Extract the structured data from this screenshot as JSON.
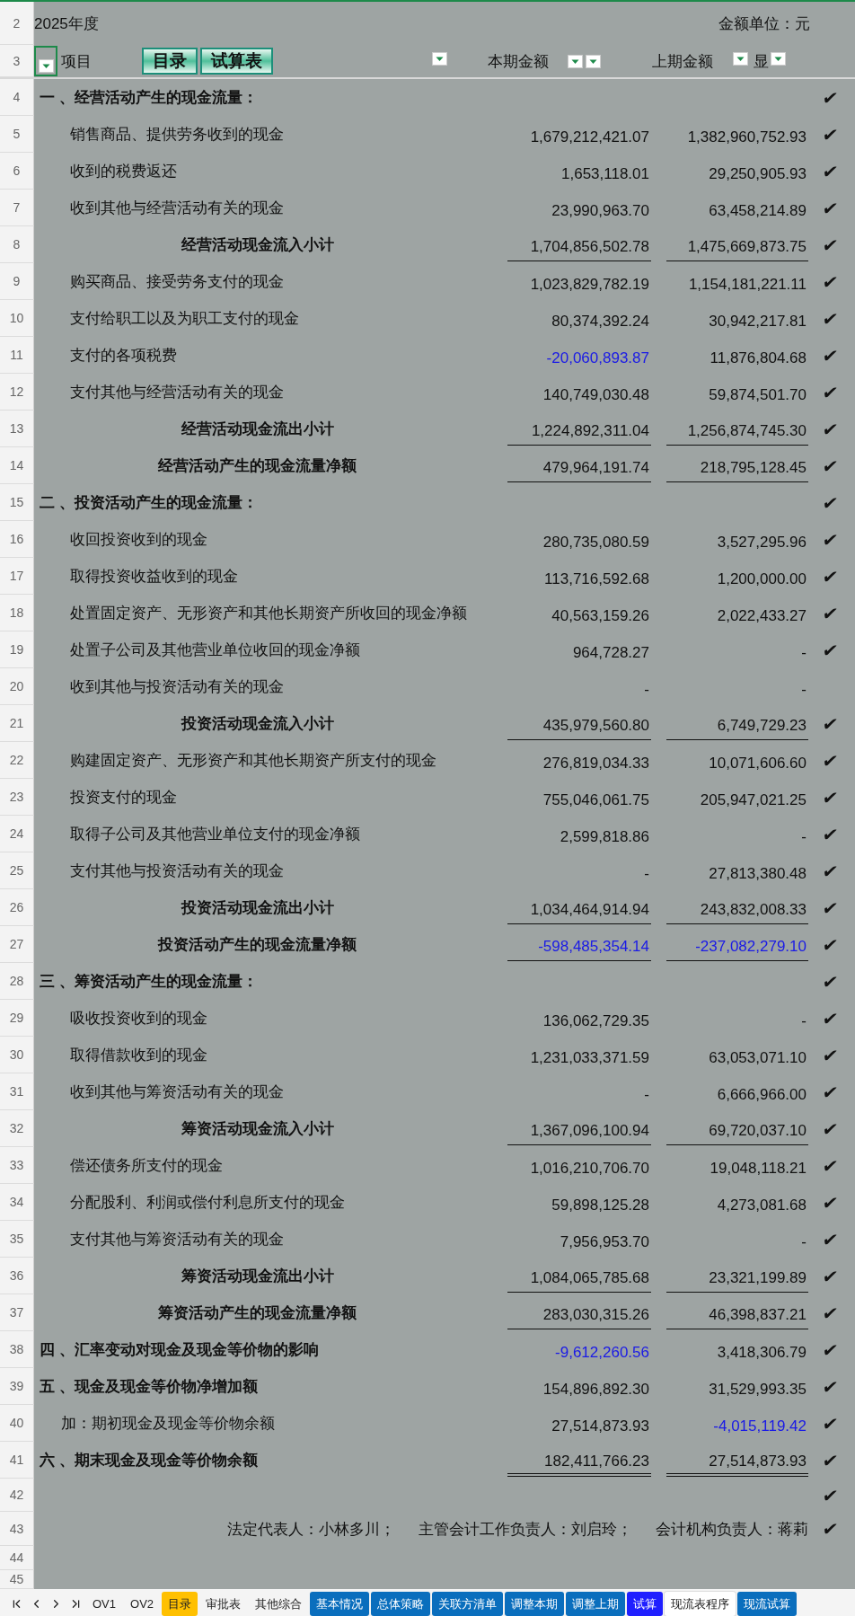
{
  "top": {
    "row": "2",
    "year": "2025年度",
    "unit": "金额单位：元"
  },
  "header": {
    "row": "3",
    "label": "项目",
    "buttons": [
      "目录",
      "试算表"
    ],
    "columns": [
      "本期金额",
      "上期金额",
      "显"
    ]
  },
  "rows": [
    {
      "row": "4",
      "kind": "section",
      "underlined": false,
      "double_rule": false,
      "label": "一 、经营活动产生的现金流量：",
      "check": "✔"
    },
    {
      "row": "5",
      "kind": "item",
      "underlined": false,
      "double_rule": false,
      "label": "销售商品、提供劳务收到的现金",
      "current": {
        "text": "1,679,212,421.07",
        "negative": false
      },
      "prior": {
        "text": "1,382,960,752.93",
        "negative": false
      },
      "check": "✔"
    },
    {
      "row": "6",
      "kind": "item",
      "underlined": false,
      "double_rule": false,
      "label": "收到的税费返还",
      "current": {
        "text": "1,653,118.01",
        "negative": false
      },
      "prior": {
        "text": "29,250,905.93",
        "negative": false
      },
      "check": "✔"
    },
    {
      "row": "7",
      "kind": "item",
      "underlined": false,
      "double_rule": false,
      "label": "收到其他与经营活动有关的现金",
      "current": {
        "text": "23,990,963.70",
        "negative": false
      },
      "prior": {
        "text": "63,458,214.89",
        "negative": false
      },
      "check": "✔"
    },
    {
      "row": "8",
      "kind": "total",
      "underlined": true,
      "double_rule": false,
      "label": "经营活动现金流入小计",
      "current": {
        "text": "1,704,856,502.78",
        "negative": false
      },
      "prior": {
        "text": "1,475,669,873.75",
        "negative": false
      },
      "check": "✔"
    },
    {
      "row": "9",
      "kind": "item",
      "underlined": false,
      "double_rule": false,
      "label": "购买商品、接受劳务支付的现金",
      "current": {
        "text": "1,023,829,782.19",
        "negative": false
      },
      "prior": {
        "text": "1,154,181,221.11",
        "negative": false
      },
      "check": "✔"
    },
    {
      "row": "10",
      "kind": "item",
      "underlined": false,
      "double_rule": false,
      "label": "支付给职工以及为职工支付的现金",
      "current": {
        "text": "80,374,392.24",
        "negative": false
      },
      "prior": {
        "text": "30,942,217.81",
        "negative": false
      },
      "check": "✔"
    },
    {
      "row": "11",
      "kind": "item",
      "underlined": false,
      "double_rule": false,
      "label": "支付的各项税费",
      "current": {
        "text": "-20,060,893.87",
        "negative": true
      },
      "prior": {
        "text": "11,876,804.68",
        "negative": false
      },
      "check": "✔"
    },
    {
      "row": "12",
      "kind": "item",
      "underlined": false,
      "double_rule": false,
      "label": "支付其他与经营活动有关的现金",
      "current": {
        "text": "140,749,030.48",
        "negative": false
      },
      "prior": {
        "text": "59,874,501.70",
        "negative": false
      },
      "check": "✔"
    },
    {
      "row": "13",
      "kind": "total",
      "underlined": true,
      "double_rule": false,
      "label": "经营活动现金流出小计",
      "current": {
        "text": "1,224,892,311.04",
        "negative": false
      },
      "prior": {
        "text": "1,256,874,745.30",
        "negative": false
      },
      "check": "✔"
    },
    {
      "row": "14",
      "kind": "total",
      "underlined": true,
      "double_rule": false,
      "label": "经营活动产生的现金流量净额",
      "current": {
        "text": "479,964,191.74",
        "negative": false
      },
      "prior": {
        "text": "218,795,128.45",
        "negative": false
      },
      "check": "✔"
    },
    {
      "row": "15",
      "kind": "section",
      "underlined": false,
      "double_rule": false,
      "label": "二 、投资活动产生的现金流量：",
      "check": "✔"
    },
    {
      "row": "16",
      "kind": "item",
      "underlined": false,
      "double_rule": false,
      "label": "收回投资收到的现金",
      "current": {
        "text": "280,735,080.59",
        "negative": false
      },
      "prior": {
        "text": "3,527,295.96",
        "negative": false
      },
      "check": "✔"
    },
    {
      "row": "17",
      "kind": "item",
      "underlined": false,
      "double_rule": false,
      "label": "取得投资收益收到的现金",
      "current": {
        "text": "113,716,592.68",
        "negative": false
      },
      "prior": {
        "text": "1,200,000.00",
        "negative": false
      },
      "check": "✔"
    },
    {
      "row": "18",
      "kind": "item",
      "underlined": false,
      "double_rule": false,
      "label": "处置固定资产、无形资产和其他长期资产所收回的现金净额",
      "current": {
        "text": "40,563,159.26",
        "negative": false
      },
      "prior": {
        "text": "2,022,433.27",
        "negative": false
      },
      "check": "✔"
    },
    {
      "row": "19",
      "kind": "item",
      "underlined": false,
      "double_rule": false,
      "label": "处置子公司及其他营业单位收回的现金净额",
      "current": {
        "text": "964,728.27",
        "negative": false
      },
      "prior": {
        "text": "-",
        "negative": false
      },
      "check": "✔"
    },
    {
      "row": "20",
      "kind": "item",
      "underlined": false,
      "double_rule": false,
      "label": "收到其他与投资活动有关的现金",
      "current": {
        "text": "-",
        "negative": false
      },
      "prior": {
        "text": "-",
        "negative": false
      }
    },
    {
      "row": "21",
      "kind": "total",
      "underlined": true,
      "double_rule": false,
      "label": "投资活动现金流入小计",
      "current": {
        "text": "435,979,560.80",
        "negative": false
      },
      "prior": {
        "text": "6,749,729.23",
        "negative": false
      },
      "check": "✔"
    },
    {
      "row": "22",
      "kind": "item",
      "underlined": false,
      "double_rule": false,
      "label": "购建固定资产、无形资产和其他长期资产所支付的现金",
      "current": {
        "text": "276,819,034.33",
        "negative": false
      },
      "prior": {
        "text": "10,071,606.60",
        "negative": false
      },
      "check": "✔"
    },
    {
      "row": "23",
      "kind": "item",
      "underlined": false,
      "double_rule": false,
      "label": "投资支付的现金",
      "current": {
        "text": "755,046,061.75",
        "negative": false
      },
      "prior": {
        "text": "205,947,021.25",
        "negative": false
      },
      "check": "✔"
    },
    {
      "row": "24",
      "kind": "item",
      "underlined": false,
      "double_rule": false,
      "label": "取得子公司及其他营业单位支付的现金净额",
      "current": {
        "text": "2,599,818.86",
        "negative": false
      },
      "prior": {
        "text": "-",
        "negative": false
      },
      "check": "✔"
    },
    {
      "row": "25",
      "kind": "item",
      "underlined": false,
      "double_rule": false,
      "label": "支付其他与投资活动有关的现金",
      "current": {
        "text": "-",
        "negative": false
      },
      "prior": {
        "text": "27,813,380.48",
        "negative": false
      },
      "check": "✔"
    },
    {
      "row": "26",
      "kind": "total",
      "underlined": true,
      "double_rule": false,
      "label": "投资活动现金流出小计",
      "current": {
        "text": "1,034,464,914.94",
        "negative": false
      },
      "prior": {
        "text": "243,832,008.33",
        "negative": false
      },
      "check": "✔"
    },
    {
      "row": "27",
      "kind": "total",
      "underlined": true,
      "double_rule": false,
      "label": "投资活动产生的现金流量净额",
      "current": {
        "text": "-598,485,354.14",
        "negative": true
      },
      "prior": {
        "text": "-237,082,279.10",
        "negative": true
      },
      "check": "✔"
    },
    {
      "row": "28",
      "kind": "section",
      "underlined": false,
      "double_rule": false,
      "label": "三 、筹资活动产生的现金流量：",
      "check": "✔"
    },
    {
      "row": "29",
      "kind": "item",
      "underlined": false,
      "double_rule": false,
      "label": "吸收投资收到的现金",
      "current": {
        "text": "136,062,729.35",
        "negative": false
      },
      "prior": {
        "text": "-",
        "negative": false
      },
      "check": "✔"
    },
    {
      "row": "30",
      "kind": "item",
      "underlined": false,
      "double_rule": false,
      "label": "取得借款收到的现金",
      "current": {
        "text": "1,231,033,371.59",
        "negative": false
      },
      "prior": {
        "text": "63,053,071.10",
        "negative": false
      },
      "check": "✔"
    },
    {
      "row": "31",
      "kind": "item",
      "underlined": false,
      "double_rule": false,
      "label": "收到其他与筹资活动有关的现金",
      "current": {
        "text": "-",
        "negative": false
      },
      "prior": {
        "text": "6,666,966.00",
        "negative": false
      },
      "check": "✔"
    },
    {
      "row": "32",
      "kind": "total",
      "underlined": true,
      "double_rule": false,
      "label": "筹资活动现金流入小计",
      "current": {
        "text": "1,367,096,100.94",
        "negative": false
      },
      "prior": {
        "text": "69,720,037.10",
        "negative": false
      },
      "check": "✔"
    },
    {
      "row": "33",
      "kind": "item",
      "underlined": false,
      "double_rule": false,
      "label": "偿还债务所支付的现金",
      "current": {
        "text": "1,016,210,706.70",
        "negative": false
      },
      "prior": {
        "text": "19,048,118.21",
        "negative": false
      },
      "check": "✔"
    },
    {
      "row": "34",
      "kind": "item",
      "underlined": false,
      "double_rule": false,
      "label": "分配股利、利润或偿付利息所支付的现金",
      "current": {
        "text": "59,898,125.28",
        "negative": false
      },
      "prior": {
        "text": "4,273,081.68",
        "negative": false
      },
      "check": "✔"
    },
    {
      "row": "35",
      "kind": "item",
      "underlined": false,
      "double_rule": false,
      "label": "支付其他与筹资活动有关的现金",
      "current": {
        "text": "7,956,953.70",
        "negative": false
      },
      "prior": {
        "text": "-",
        "negative": false
      },
      "check": "✔"
    },
    {
      "row": "36",
      "kind": "total",
      "underlined": true,
      "double_rule": false,
      "label": "筹资活动现金流出小计",
      "current": {
        "text": "1,084,065,785.68",
        "negative": false
      },
      "prior": {
        "text": "23,321,199.89",
        "negative": false
      },
      "check": "✔"
    },
    {
      "row": "37",
      "kind": "total",
      "underlined": true,
      "double_rule": false,
      "label": "筹资活动产生的现金流量净额",
      "current": {
        "text": "283,030,315.26",
        "negative": false
      },
      "prior": {
        "text": "46,398,837.21",
        "negative": false
      },
      "check": "✔"
    },
    {
      "row": "38",
      "kind": "section",
      "underlined": false,
      "double_rule": false,
      "label": "四 、汇率变动对现金及现金等价物的影响",
      "current": {
        "text": "-9,612,260.56",
        "negative": true
      },
      "prior": {
        "text": "3,418,306.79",
        "negative": false
      },
      "check": "✔"
    },
    {
      "row": "39",
      "kind": "section",
      "underlined": false,
      "double_rule": false,
      "label": "五 、现金及现金等价物净增加额",
      "current": {
        "text": "154,896,892.30",
        "negative": false
      },
      "prior": {
        "text": "31,529,993.35",
        "negative": false
      },
      "check": "✔"
    },
    {
      "row": "40",
      "kind": "addend",
      "underlined": false,
      "double_rule": false,
      "label": "加：期初现金及现金等价物余额",
      "current": {
        "text": "27,514,873.93",
        "negative": false
      },
      "prior": {
        "text": "-4,015,119.42",
        "negative": true
      },
      "check": "✔"
    },
    {
      "row": "41",
      "kind": "section",
      "underlined": false,
      "double_rule": true,
      "label": "六 、期末现金及现金等价物余额",
      "current": {
        "text": "182,411,766.23",
        "negative": false
      },
      "prior": {
        "text": "27,514,873.93",
        "negative": false
      },
      "check": "✔"
    }
  ],
  "footer_rows": [
    {
      "row": "42",
      "check": "✔"
    },
    {
      "row": "43",
      "signatures": [
        "法定代表人：小林多川；",
        "主管会计工作负责人：刘启玲；",
        "会计机构负责人：蒋莉"
      ],
      "check": "✔"
    },
    {
      "row": "44"
    },
    {
      "row": "45"
    }
  ],
  "sheet_tabs": [
    {
      "label": "OV1",
      "selected": false
    },
    {
      "label": "OV2",
      "selected": false
    },
    {
      "label": "目录",
      "selected": false,
      "color": "#ffc000"
    },
    {
      "label": "审批表",
      "selected": false
    },
    {
      "label": "其他综合",
      "selected": false
    },
    {
      "label": "基本情况",
      "selected": false,
      "color": "#0a6ebd"
    },
    {
      "label": "总体策略",
      "selected": false,
      "color": "#0a6ebd"
    },
    {
      "label": "关联方清单",
      "selected": false,
      "color": "#0a6ebd"
    },
    {
      "label": "调整本期",
      "selected": false,
      "color": "#0a6ebd"
    },
    {
      "label": "调整上期",
      "selected": false,
      "color": "#0a6ebd"
    },
    {
      "label": "试算",
      "selected": false,
      "color": "#1f1fff"
    },
    {
      "label": "现流表程序",
      "selected": true
    },
    {
      "label": "现流试算",
      "selected": false,
      "color": "#0a6ebd"
    }
  ]
}
